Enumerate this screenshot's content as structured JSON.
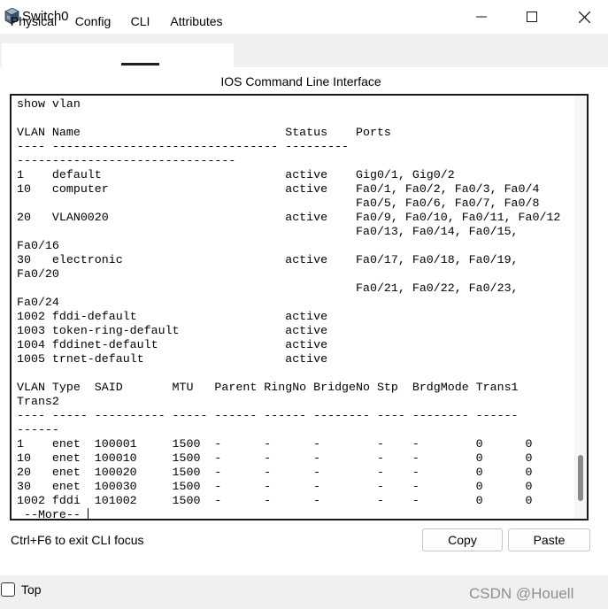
{
  "window": {
    "title": "Switch0",
    "icon": "switch-device-icon",
    "controls": [
      "minimize-icon",
      "maximize-icon",
      "close-icon"
    ]
  },
  "tabs": [
    {
      "label": "Physical"
    },
    {
      "label": "Config"
    },
    {
      "label": "CLI",
      "active": true
    },
    {
      "label": "Attributes"
    }
  ],
  "panel": {
    "heading": "IOS Command Line Interface"
  },
  "cli": {
    "output": "show vlan\n\nVLAN Name                             Status    Ports\n---- -------------------------------- ---------\n-------------------------------\n1    default                          active    Gig0/1, Gig0/2\n10   computer                         active    Fa0/1, Fa0/2, Fa0/3, Fa0/4\n                                                Fa0/5, Fa0/6, Fa0/7, Fa0/8\n20   VLAN0020                         active    Fa0/9, Fa0/10, Fa0/11, Fa0/12\n                                                Fa0/13, Fa0/14, Fa0/15,\nFa0/16\n30   electronic                       active    Fa0/17, Fa0/18, Fa0/19,\nFa0/20\n                                                Fa0/21, Fa0/22, Fa0/23,\nFa0/24\n1002 fddi-default                     active\n1003 token-ring-default               active\n1004 fddinet-default                  active\n1005 trnet-default                    active\n\nVLAN Type  SAID       MTU   Parent RingNo BridgeNo Stp  BrdgMode Trans1\nTrans2\n---- ----- ---------- ----- ------ ------ -------- ---- -------- ------\n------\n1    enet  100001     1500  -      -      -        -    -        0      0\n10   enet  100010     1500  -      -      -        -    -        0      0\n20   enet  100020     1500  -      -      -        -    -        0      0\n30   enet  100030     1500  -      -      -        -    -        0      0\n1002 fddi  101002     1500  -      -      -        -    -        0      0\n --More-- "
  },
  "footer": {
    "hint": "Ctrl+F6 to exit CLI focus",
    "copy_label": "Copy",
    "paste_label": "Paste"
  },
  "bottom": {
    "top_label": "Top",
    "top_checked": false,
    "watermark": "CSDN @Houell"
  }
}
